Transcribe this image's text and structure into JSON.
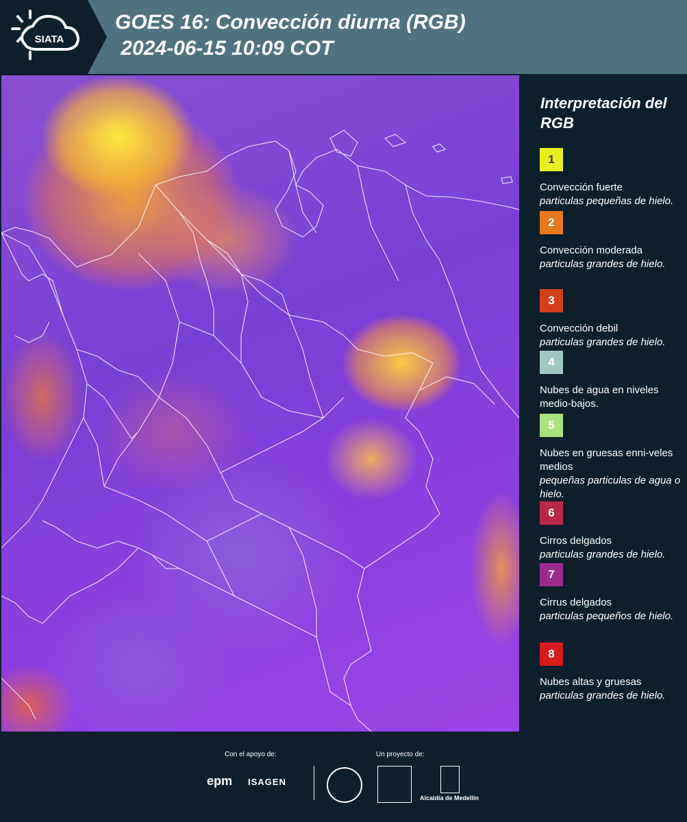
{
  "header": {
    "logo_text": "SIATA",
    "title": "GOES 16: Convección diurna (RGB)\n 2024-06-15 10:09 COT"
  },
  "map": {
    "icon": "satellite-image"
  },
  "legend": {
    "title": "Interpretación del RGB",
    "items": [
      {
        "number": "1",
        "color": "#e8ef1e",
        "text_color": "#333333",
        "label": "Convección fuerte",
        "desc": "particulas pequeñas de hielo."
      },
      {
        "number": "2",
        "color": "#e6781f",
        "text_color": "#ffffff",
        "label": "Convección moderada",
        "desc": "particulas grandes de hielo."
      },
      {
        "number": "3",
        "color": "#d4401c",
        "text_color": "#ffffff",
        "label": "Convección debil",
        "desc": "particulas grandes de hielo."
      },
      {
        "number": "4",
        "color": "#9fc8c3",
        "text_color": "#ffffff",
        "label": "Nubes de agua en niveles medio-bajos.",
        "desc": ""
      },
      {
        "number": "5",
        "color": "#a8e27c",
        "text_color": "#ffffff",
        "label": "Nubes en gruesas enni-veles medios",
        "desc": "pequeñas particulas de agua o hielo."
      },
      {
        "number": "6",
        "color": "#b9284a",
        "text_color": "#ffffff",
        "label": "Cirros delgados",
        "desc": "particulas grandes de hielo."
      },
      {
        "number": "7",
        "color": "#9c2b8e",
        "text_color": "#ffffff",
        "label": "Cirrus delgados",
        "desc": "particulas pequeños de hielo."
      },
      {
        "number": "8",
        "color": "#d61c1c",
        "text_color": "#ffffff",
        "label": "Nubes altas y gruesas",
        "desc": "particulas grandes de hielo."
      }
    ]
  },
  "footer": {
    "support_label": "Con el apoyo de:",
    "project_label": "Un proyecto de:",
    "epm": "epm",
    "isagen": "ISAGEN",
    "alcaldia": "Alcaldía de Medellín"
  }
}
